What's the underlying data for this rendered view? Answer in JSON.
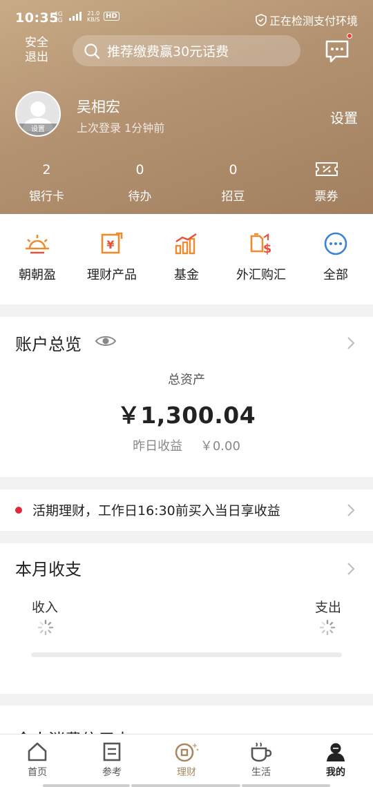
{
  "status": {
    "time": "10:35",
    "net_top": "4G",
    "net_bottom": "2G",
    "speed_top": "21.0",
    "speed_bottom": "KB/S",
    "hd": "HD",
    "security": "正在检测支付环境"
  },
  "header": {
    "exit_label": "安全退出",
    "search_placeholder": "推荐缴费赢30元话费",
    "user_name": "吴相宏",
    "last_login": "上次登录 1分钟前",
    "avatar_label": "设置",
    "settings_label": "设置"
  },
  "stats": [
    {
      "value": "2",
      "label": "银行卡"
    },
    {
      "value": "0",
      "label": "待办"
    },
    {
      "value": "0",
      "label": "招豆"
    },
    {
      "label": "票券",
      "icon": "ticket-icon"
    }
  ],
  "shortcuts": [
    {
      "label": "朝朝盈",
      "icon": "sunrise-icon"
    },
    {
      "label": "理财产品",
      "icon": "wealth-product-icon"
    },
    {
      "label": "基金",
      "icon": "fund-chart-icon"
    },
    {
      "label": "外汇购汇",
      "icon": "forex-icon"
    },
    {
      "label": "全部",
      "icon": "more-icon"
    }
  ],
  "overview": {
    "title": "账户总览",
    "total_label": "总资产",
    "total_value": "￥1,300.04",
    "yesterday_label": "昨日收益",
    "yesterday_value": "￥0.00"
  },
  "notice": {
    "text": "活期理财，工作日16:30前买入当日享收益"
  },
  "monthly": {
    "title": "本月收支",
    "income_label": "收入",
    "expense_label": "支出"
  },
  "next_card": {
    "title": "今人消费信用卡"
  },
  "tabs": [
    {
      "label": "首页",
      "icon": "home-icon"
    },
    {
      "label": "参考",
      "icon": "document-icon"
    },
    {
      "label": "理财",
      "icon": "coin-icon"
    },
    {
      "label": "生活",
      "icon": "coffee-cup-icon"
    },
    {
      "label": "我的",
      "icon": "user-icon"
    }
  ],
  "colors": {
    "header_gold": "#b39271",
    "accent_orange": "#f08a2c",
    "accent_blue": "#3b82d6",
    "notice_red": "#e0283c"
  }
}
